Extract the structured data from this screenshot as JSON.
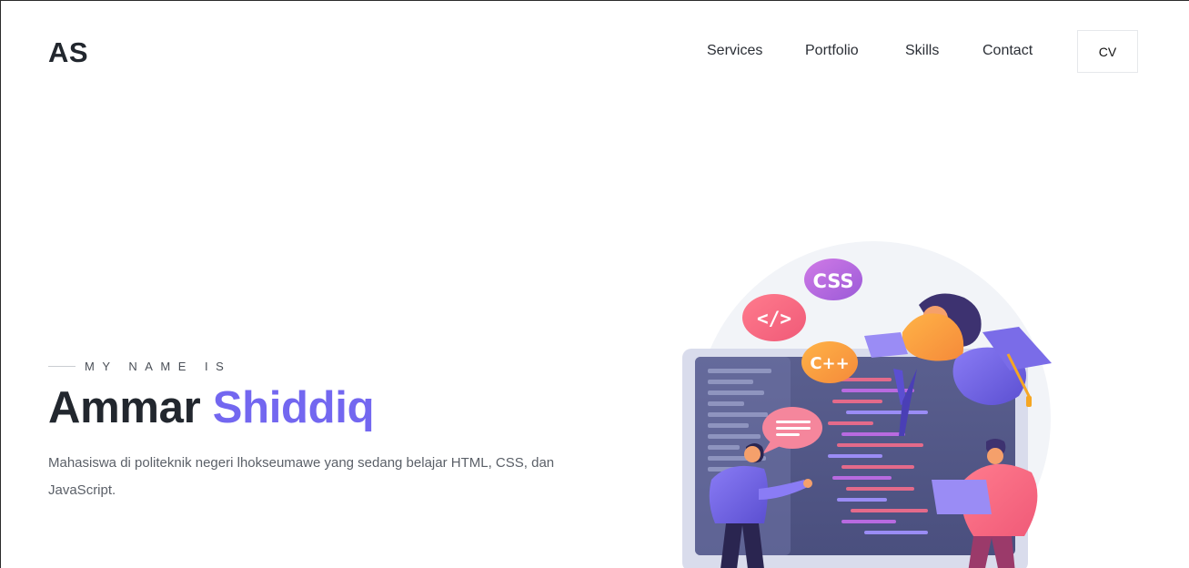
{
  "header": {
    "brand": "AS",
    "nav": [
      "Services",
      "Portfolio",
      "Skills",
      "Contact"
    ],
    "cv_label": "CV"
  },
  "hero": {
    "eyebrow": "MY NAME IS",
    "first_name": "Ammar",
    "last_name": "Shiddiq",
    "description": "Mahasiswa di politeknik negeri lhokseumawe yang sedang belajar HTML, CSS, dan JavaScript."
  },
  "illustration": {
    "badges": [
      "CSS",
      "</>",
      "C++"
    ],
    "icon": "developer-team-illustration"
  },
  "colors": {
    "accent": "#7367f0",
    "heading": "#22272e",
    "body_text": "#5b6068"
  }
}
